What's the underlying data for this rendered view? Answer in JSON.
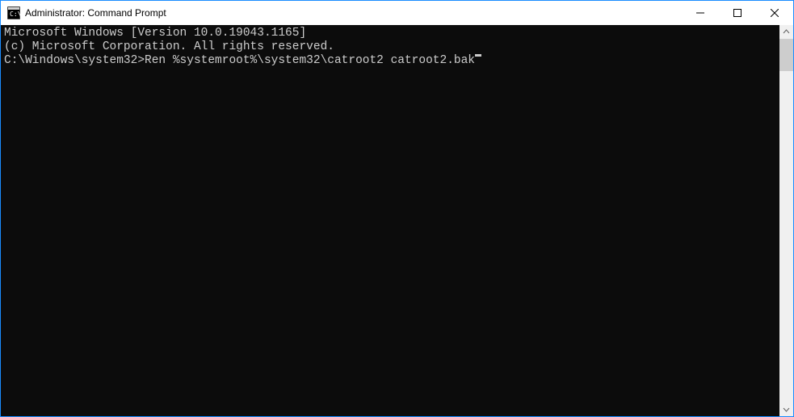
{
  "titlebar": {
    "title": "Administrator: Command Prompt"
  },
  "terminal": {
    "line1": "Microsoft Windows [Version 10.0.19043.1165]",
    "line2": "(c) Microsoft Corporation. All rights reserved.",
    "blank": "",
    "prompt": "C:\\Windows\\system32>",
    "command": "Ren %systemroot%\\system32\\catroot2 catroot2.bak"
  }
}
